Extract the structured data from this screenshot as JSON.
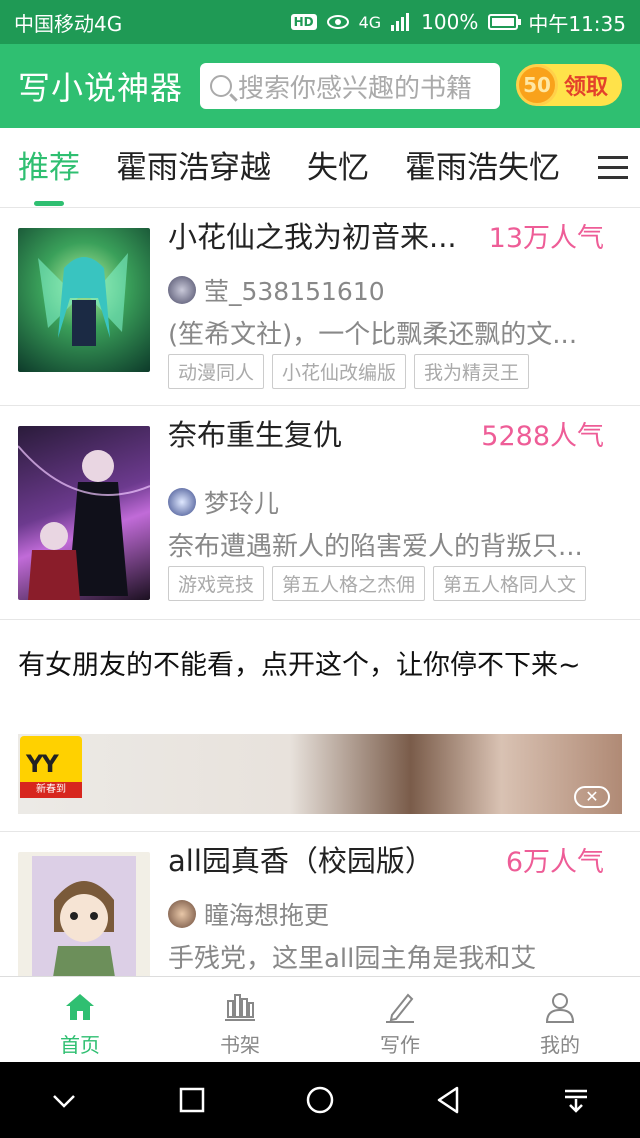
{
  "status_bar": {
    "carrier": "中国移动4G",
    "hd": "HD",
    "network": "4G",
    "battery": "100%",
    "time": "中午11:35"
  },
  "header": {
    "title": "写小说神器",
    "search_placeholder": "搜索你感兴趣的书籍",
    "coin_value": "50",
    "claim_label": "领取"
  },
  "tabs": [
    "推荐",
    "霍雨浩穿越",
    "失忆",
    "霍雨浩失忆"
  ],
  "books": [
    {
      "title": "小花仙之我为初音来...",
      "popularity": "13万人气",
      "author": "莹_538151610",
      "description": "(笙希文社)，一个比飘柔还飘的文...",
      "tags": [
        "动漫同人",
        "小花仙改编版",
        "我为精灵王"
      ]
    },
    {
      "title": "奈布重生复仇",
      "popularity": "5288人气",
      "author": "梦玲儿",
      "description": "奈布遭遇新人的陷害爱人的背叛只...",
      "tags": [
        "游戏竞技",
        "第五人格之杰佣",
        "第五人格同人文"
      ]
    },
    {
      "title": "all园真香（校园版）",
      "popularity": "6万人气",
      "author": "瞳海想拖更",
      "description": "手残党，这里all园主角是我和艾",
      "tags": []
    }
  ],
  "ad": {
    "text": "有女朋友的不能看，点开这个，让你停不下来~",
    "logo_text": "YY",
    "logo_sub": "新春到"
  },
  "bottom_nav": [
    {
      "label": "首页",
      "icon": "home-icon",
      "active": true
    },
    {
      "label": "书架",
      "icon": "bookshelf-icon",
      "active": false
    },
    {
      "label": "写作",
      "icon": "pencil-icon",
      "active": false
    },
    {
      "label": "我的",
      "icon": "profile-icon",
      "active": false
    }
  ],
  "colors": {
    "accent": "#2fbf71",
    "popularity": "#ee5d97",
    "claim_bg": "#ffe24a"
  }
}
